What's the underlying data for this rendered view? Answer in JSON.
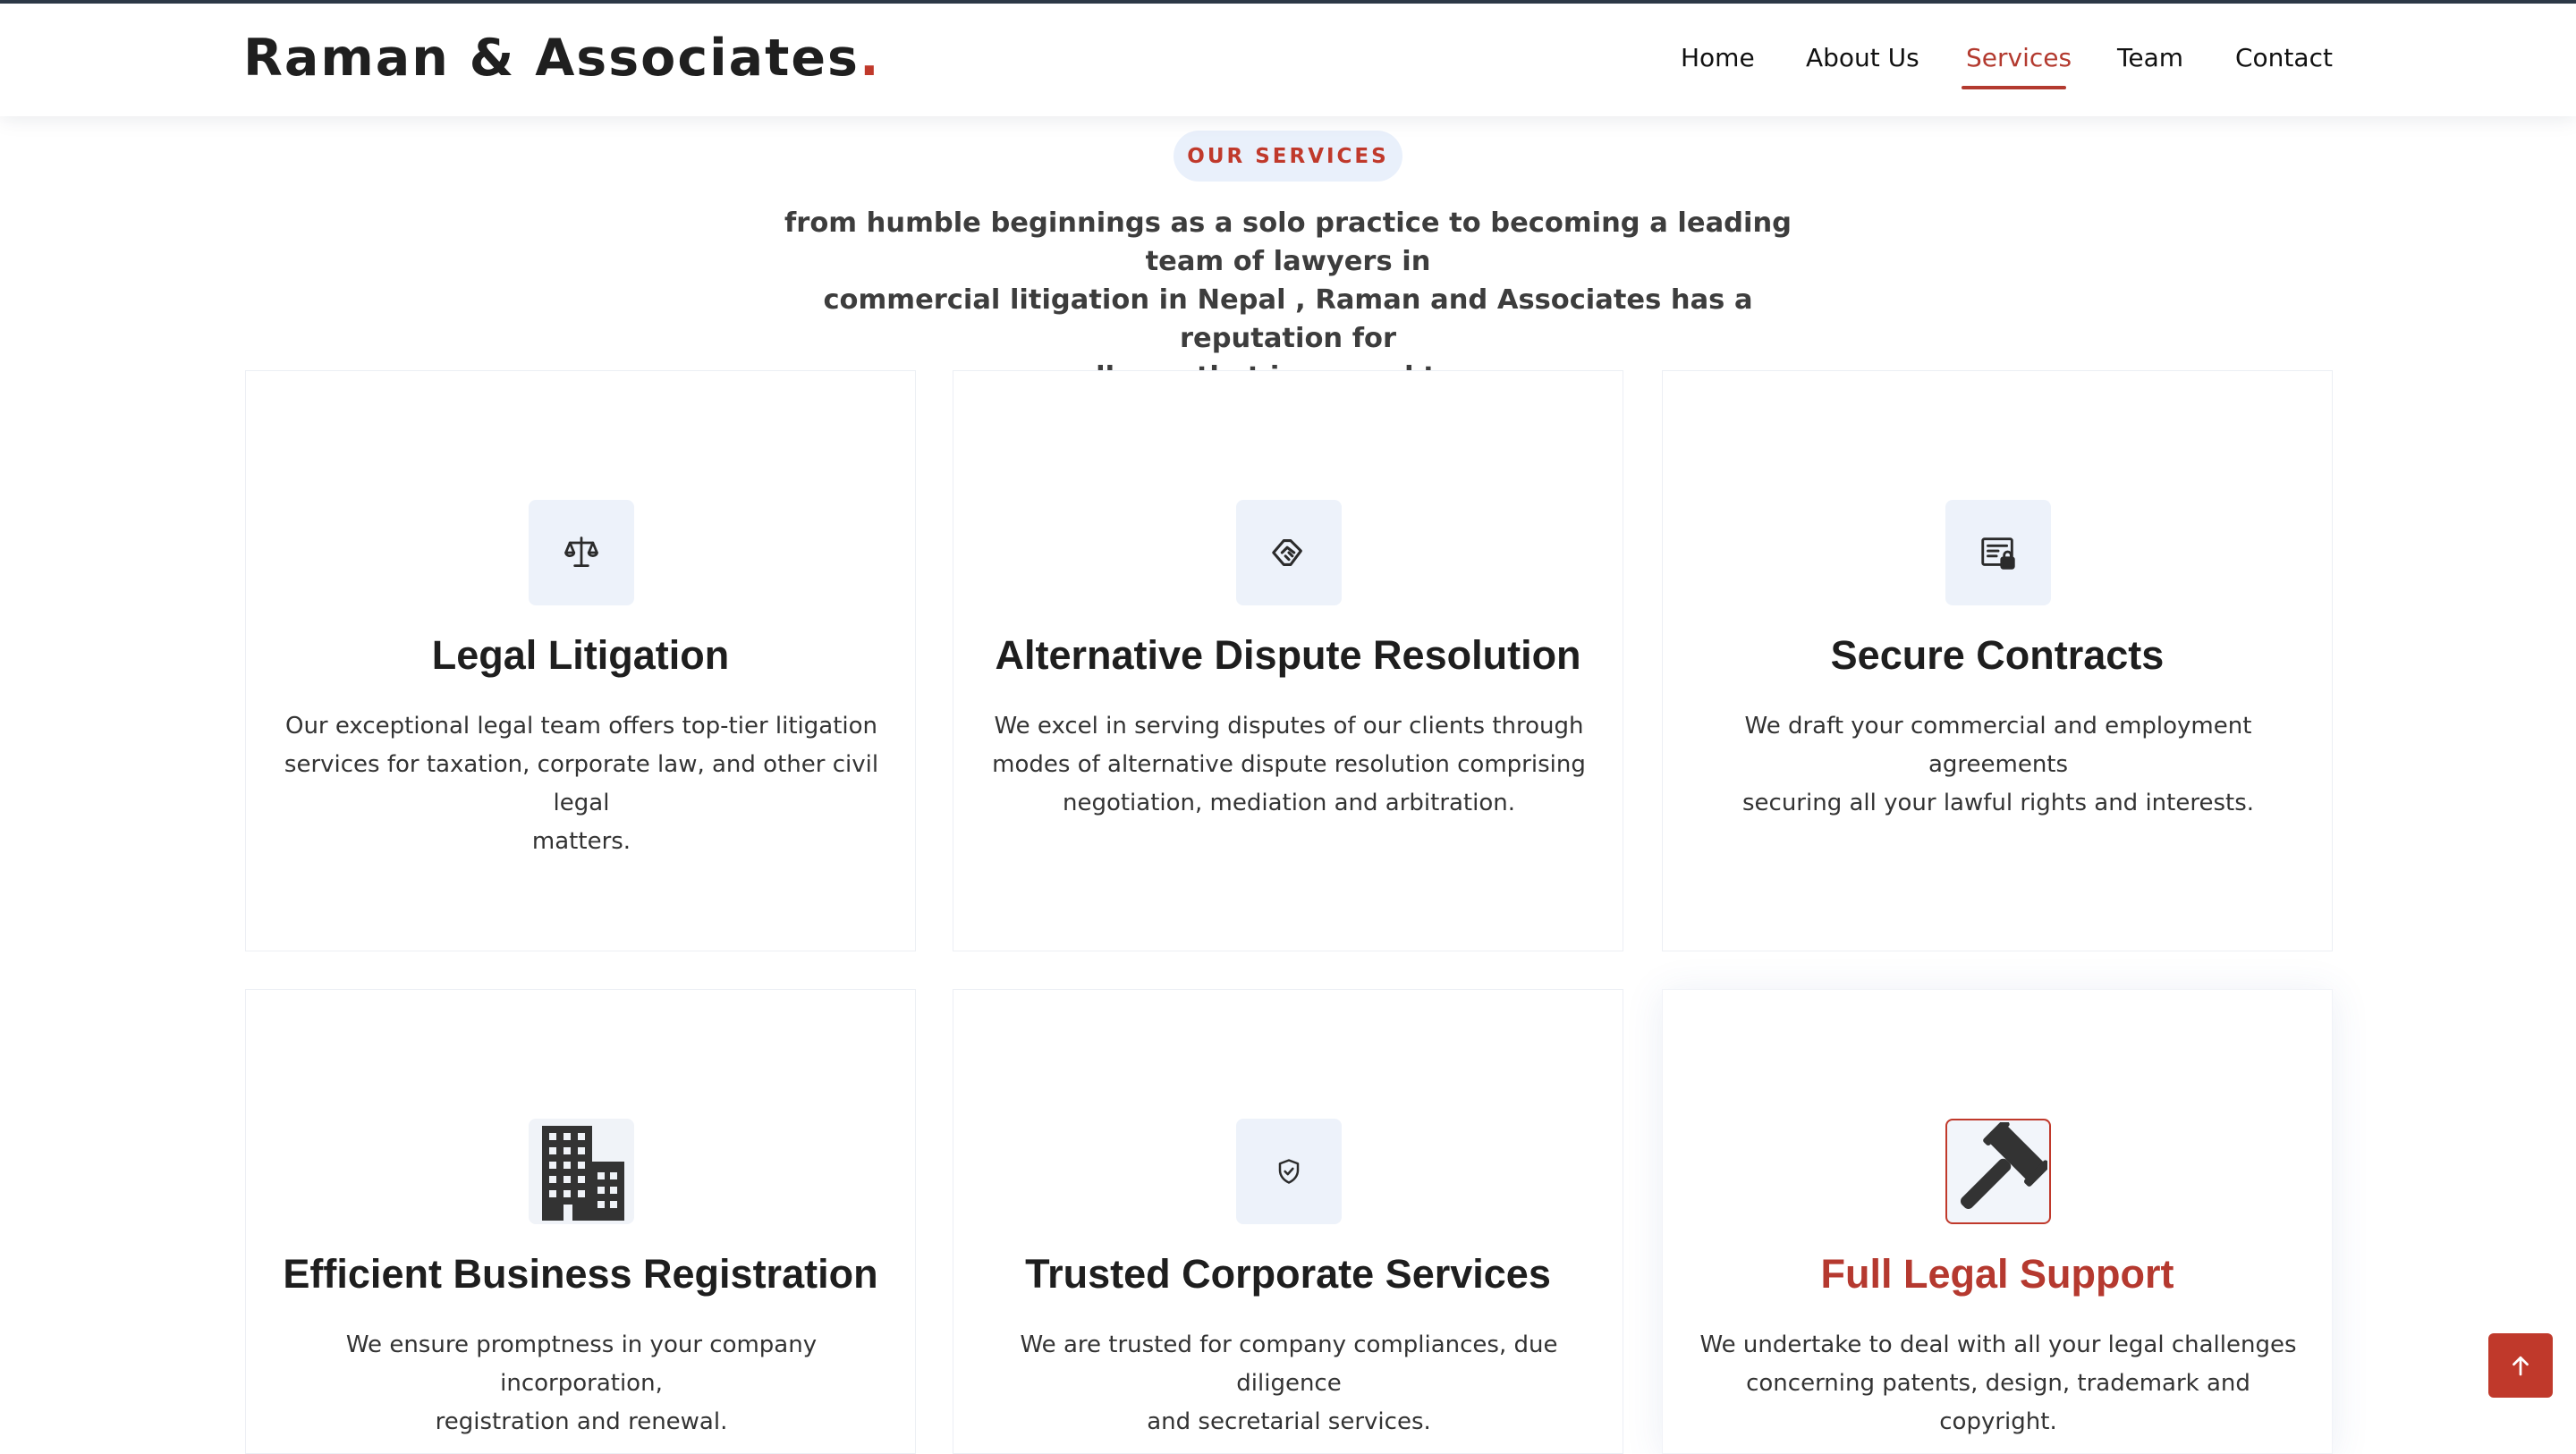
{
  "header": {
    "brand_name": "Raman & Associates",
    "brand_dot": ".",
    "nav": [
      {
        "label": "Home",
        "active": false
      },
      {
        "label": "About Us",
        "active": false
      },
      {
        "label": "Services",
        "active": true
      },
      {
        "label": "Team",
        "active": false
      },
      {
        "label": "Contact",
        "active": false
      }
    ]
  },
  "section": {
    "eyebrow": "OUR SERVICES",
    "intro_lines": [
      "from humble beginnings as a solo practice to becoming a leading team of lawyers in",
      "commercial litigation in Nepal , Raman and Associates has a reputation for",
      "excellence that is second to none."
    ]
  },
  "services": [
    {
      "icon": "scales-icon",
      "title": "Legal Litigation",
      "desc_lines": [
        "Our exceptional legal team offers top-tier litigation",
        "services for taxation, corporate law, and other civil legal",
        "matters."
      ]
    },
    {
      "icon": "handshake-icon",
      "title": "Alternative Dispute Resolution",
      "desc_lines": [
        "We excel in serving disputes of our clients through",
        "modes of alternative dispute resolution comprising",
        "negotiation, mediation and arbitration."
      ]
    },
    {
      "icon": "document-lock-icon",
      "title": "Secure Contracts",
      "desc_lines": [
        "We draft your commercial and employment agreements",
        "securing all your lawful rights and interests."
      ]
    },
    {
      "icon": "building-icon",
      "title": "Efficient Business Registration",
      "desc_lines": [
        "We ensure promptness in your company incorporation,",
        "registration and renewal."
      ]
    },
    {
      "icon": "shield-check-icon",
      "title": "Trusted Corporate Services",
      "desc_lines": [
        "We are trusted for company compliances, due diligence",
        "and secretarial services."
      ]
    },
    {
      "icon": "gavel-icon",
      "title": "Full Legal Support",
      "desc_lines": [
        "We undertake to deal with all your legal challenges",
        "concerning patents, design, trademark and copyright."
      ]
    }
  ],
  "colors": {
    "accent": "#c0392b",
    "pill_bg": "#e9f0fb",
    "icon_bg": "#edf2fa",
    "text": "#212529"
  },
  "back_to_top_icon": "arrow-up-icon"
}
